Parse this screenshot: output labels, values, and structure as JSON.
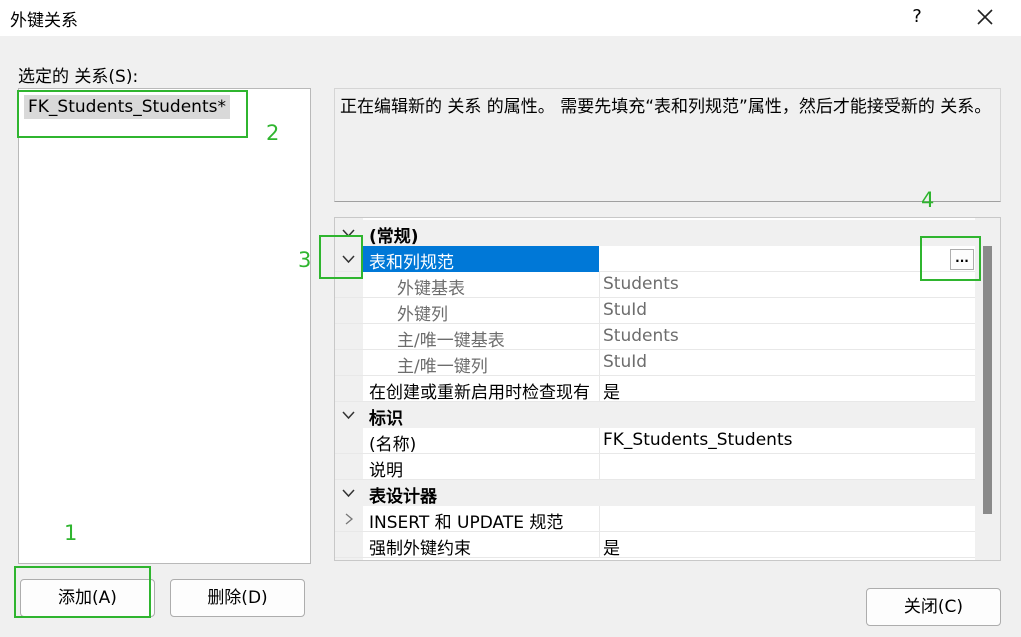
{
  "window": {
    "title": "外键关系",
    "help": "?"
  },
  "relations": {
    "label": "选定的 关系(S):",
    "items": [
      "FK_Students_Students*"
    ]
  },
  "description": "正在编辑新的 关系 的属性。 需要先填充“表和列规范”属性，然后才能接受新的 关系。",
  "grid": {
    "categories": [
      "(常规)",
      "标识",
      "表设计器"
    ],
    "general": {
      "spec_name": "表和列规范",
      "ellipsis": "...",
      "sub": [
        {
          "name": "外键基表",
          "value": "Students"
        },
        {
          "name": "外键列",
          "value": "StuId"
        },
        {
          "name": "主/唯一键基表",
          "value": "Students"
        },
        {
          "name": "主/唯一键列",
          "value": "StuId"
        }
      ],
      "check": {
        "name": "在创建或重新启用时检查现有",
        "value": "是"
      }
    },
    "identity": [
      {
        "name": "(名称)",
        "value": "FK_Students_Students"
      },
      {
        "name": "说明",
        "value": ""
      }
    ],
    "designer": [
      {
        "name": "INSERT 和 UPDATE 规范",
        "value": ""
      },
      {
        "name": "强制外键约束",
        "value": "是"
      }
    ]
  },
  "buttons": {
    "add": "添加(A)",
    "delete": "删除(D)",
    "close": "关闭(C)"
  },
  "annotations": [
    "1",
    "2",
    "3",
    "4"
  ],
  "colors": {
    "selection": "#0078d7",
    "highlight": "#2fb52f"
  }
}
